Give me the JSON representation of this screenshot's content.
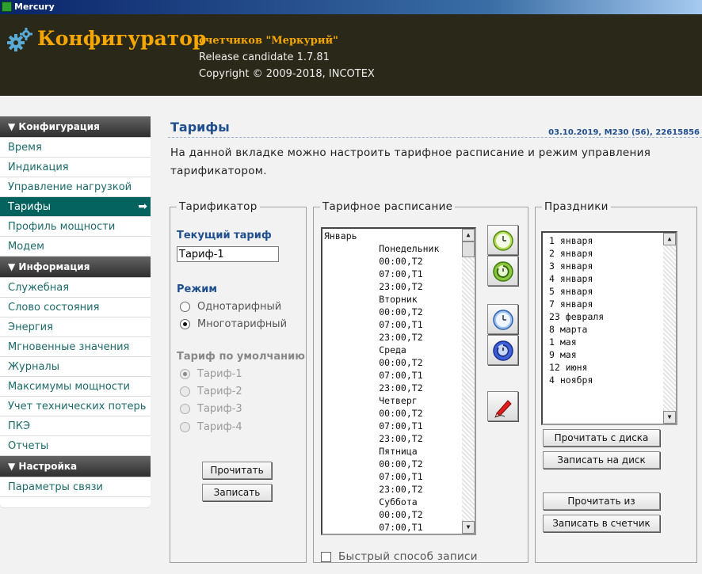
{
  "window": {
    "title": "Mercury"
  },
  "header": {
    "brand": "Конфигуратор",
    "subtitle": "счетчиков \"Меркурий\"",
    "release": "Release candidate 1.7.81",
    "copyright": "Copyright © 2009-2018, INCOTEX"
  },
  "sidebar": {
    "sections": [
      {
        "title": "▼ Конфигурация",
        "items": [
          "Время",
          "Индикация",
          "Управление нагрузкой",
          "Тарифы",
          "Профиль мощности",
          "Модем"
        ]
      },
      {
        "title": "▼ Информация",
        "items": [
          "Служебная",
          "Слово состояния",
          "Энергия",
          "Мгновенные значения",
          "Журналы",
          "Максимумы мощности",
          "Учет технических потерь",
          "ПКЭ",
          "Отчеты"
        ]
      },
      {
        "title": "▼ Настройка",
        "items": [
          "Параметры связи"
        ]
      }
    ],
    "active_item": "Тарифы"
  },
  "page": {
    "title": "Тарифы",
    "device_info": "03.10.2019, M230 (56), 22615856",
    "description": "На данной вкладке можно настроить тарифное расписание и режим управления тарификатором."
  },
  "tarificator": {
    "legend": "Тарификатор",
    "current_tariff_label": "Текущий тариф",
    "current_tariff_value": "Тариф-1",
    "mode_label": "Режим",
    "mode_single": "Однотарифный",
    "mode_multi": "Многотарифный",
    "default_label": "Тариф по умолчанию",
    "defaults": [
      "Тариф-1",
      "Тариф-2",
      "Тариф-3",
      "Тариф-4"
    ],
    "read_button": "Прочитать",
    "write_button": "Записать"
  },
  "schedule": {
    "legend": "Тарифное расписание",
    "lines": [
      "Январь",
      "          Понедельник",
      "          00:00,T2",
      "          07:00,T1",
      "          23:00,T2",
      "          Вторник",
      "          00:00,T2",
      "          07:00,T1",
      "          23:00,T2",
      "          Среда",
      "          00:00,T2",
      "          07:00,T1",
      "          23:00,T2",
      "          Четверг",
      "          00:00,T2",
      "          07:00,T1",
      "          23:00,T2",
      "          Пятница",
      "          00:00,T2",
      "          07:00,T1",
      "          23:00,T2",
      "          Суббота",
      "          00:00,T2",
      "          07:00,T1"
    ],
    "fast_write_label": "Быстрый способ записи"
  },
  "holidays": {
    "legend": "Праздники",
    "items": [
      "1 января",
      "2 января",
      "3 января",
      "4 января",
      "5 января",
      "7 января",
      "23 февраля",
      "8 марта",
      "1 мая",
      "9 мая",
      "12 июня",
      "4 ноября"
    ],
    "read_disk": "Прочитать с диска",
    "write_disk": "Записать на диск",
    "read_meter": "Прочитать из счетчика",
    "write_meter": "Записать в счетчик"
  }
}
